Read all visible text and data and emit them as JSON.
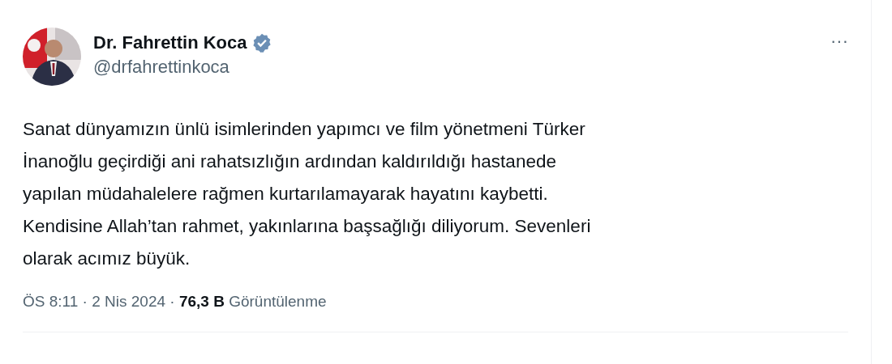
{
  "author": {
    "name": "Dr. Fahrettin Koca",
    "handle": "@drfahrettinkoca",
    "verified": true
  },
  "more_button": "···",
  "text": "Sanat dünyamızın ünlü isimlerinden yapımcı ve film yönetmeni Türker\nİnanoğlu geçirdiği ani rahatsızlığın ardından kaldırıldığı hastanede\nyapılan müdahalelere rağmen kurtarılamayarak hayatını kaybetti.\nKendisine Allah’tan rahmet, yakınlarına başsağlığı diliyorum. Sevenleri\nolarak acımız büyük.",
  "meta": "ÖS 8:11 · 2 Nis 2024 · **76,3 B** Görüntülenme"
}
